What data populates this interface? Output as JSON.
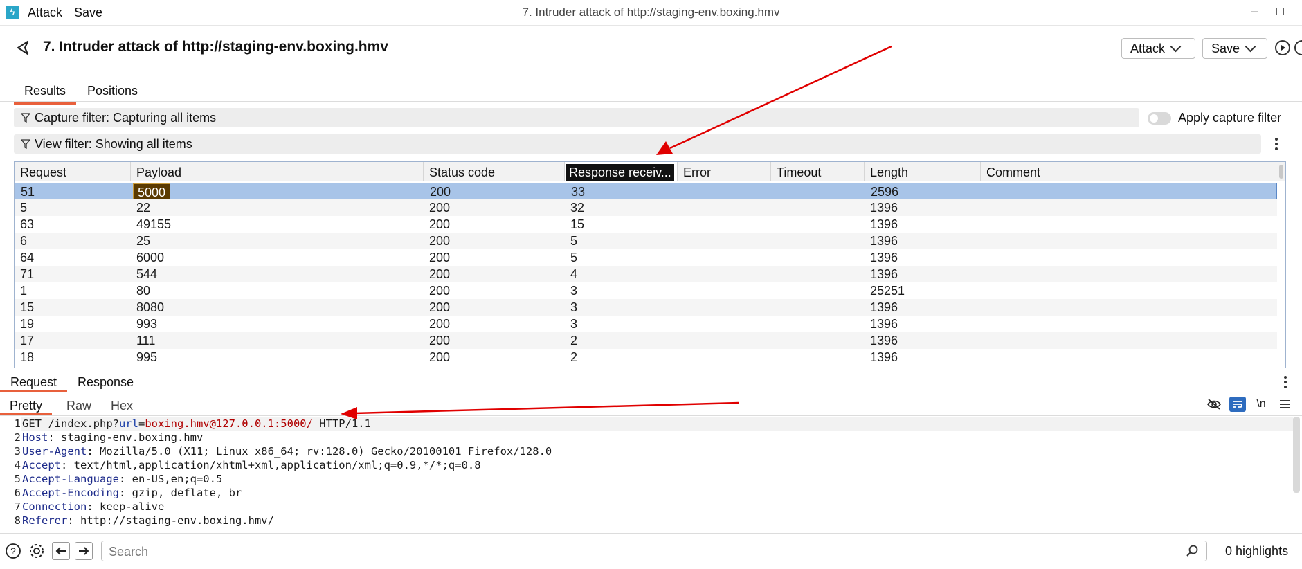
{
  "titlebar": {
    "menu": [
      "Attack",
      "Save"
    ],
    "window_title": "7. Intruder attack of http://staging-env.boxing.hmv",
    "minimize": "–",
    "maximize": "□"
  },
  "header": {
    "title": "7. Intruder attack of http://staging-env.boxing.hmv",
    "attack_button": "Attack",
    "save_button": "Save"
  },
  "tabs": [
    {
      "label": "Results",
      "active": true
    },
    {
      "label": "Positions",
      "active": false
    }
  ],
  "filters": {
    "capture": "Capture filter: Capturing all items",
    "view": "View filter: Showing all items",
    "apply_capture_label": "Apply capture filter",
    "apply_capture_enabled": false
  },
  "table": {
    "columns": [
      "Request",
      "Payload",
      "Status code",
      "Response receiv...",
      "Error",
      "Timeout",
      "Length",
      "Comment"
    ],
    "rows": [
      [
        "51",
        "5000",
        "200",
        "33",
        "",
        "",
        "2596",
        ""
      ],
      [
        "5",
        "22",
        "200",
        "32",
        "",
        "",
        "1396",
        ""
      ],
      [
        "63",
        "49155",
        "200",
        "15",
        "",
        "",
        "1396",
        ""
      ],
      [
        "6",
        "25",
        "200",
        "5",
        "",
        "",
        "1396",
        ""
      ],
      [
        "64",
        "6000",
        "200",
        "5",
        "",
        "",
        "1396",
        ""
      ],
      [
        "71",
        "544",
        "200",
        "4",
        "",
        "",
        "1396",
        ""
      ],
      [
        "1",
        "80",
        "200",
        "3",
        "",
        "",
        "25251",
        ""
      ],
      [
        "15",
        "8080",
        "200",
        "3",
        "",
        "",
        "1396",
        ""
      ],
      [
        "19",
        "993",
        "200",
        "3",
        "",
        "",
        "1396",
        ""
      ],
      [
        "17",
        "111",
        "200",
        "2",
        "",
        "",
        "1396",
        ""
      ],
      [
        "18",
        "995",
        "200",
        "2",
        "",
        "",
        "1396",
        ""
      ]
    ]
  },
  "reqres_tabs": [
    {
      "label": "Request",
      "active": true
    },
    {
      "label": "Response",
      "active": false
    }
  ],
  "view_tabs": [
    {
      "label": "Pretty",
      "active": true
    },
    {
      "label": "Raw",
      "active": false
    },
    {
      "label": "Hex",
      "active": false
    }
  ],
  "editor": {
    "line1": {
      "method": "GET ",
      "path": "/index.php?",
      "param": "url",
      "eq": "=",
      "value": "boxing.hmv@127.0.0.1:5000/",
      "proto": " HTTP/1.1"
    },
    "headers": [
      {
        "name": "Host",
        "value": " staging-env.boxing.hmv"
      },
      {
        "name": "User-Agent",
        "value": " Mozilla/5.0 (X11; Linux x86_64; rv:128.0) Gecko/20100101 Firefox/128.0"
      },
      {
        "name": "Accept",
        "value": " text/html,application/xhtml+xml,application/xml;q=0.9,*/*;q=0.8"
      },
      {
        "name": "Accept-Language",
        "value": " en-US,en;q=0.5"
      },
      {
        "name": "Accept-Encoding",
        "value": " gzip, deflate, br"
      },
      {
        "name": "Connection",
        "value": " keep-alive"
      },
      {
        "name": "Referer",
        "value": " http://staging-env.boxing.hmv/"
      }
    ],
    "newline_toggle": "\\n"
  },
  "footer": {
    "search_placeholder": "Search",
    "highlights": "0 highlights"
  },
  "colors": {
    "accent": "#e8603c",
    "selection": "#a8c4e8",
    "annotation_arrow": "#e00000"
  }
}
